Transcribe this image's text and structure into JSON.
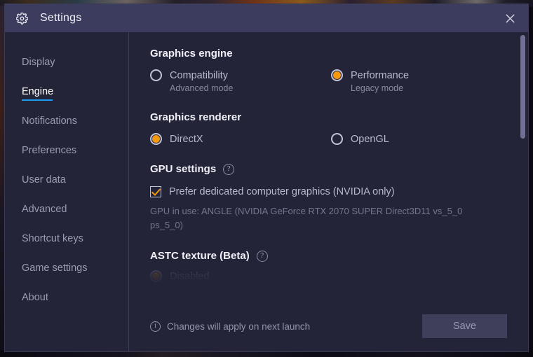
{
  "window": {
    "title": "Settings",
    "gear_icon": "gear-icon",
    "close_icon": "✕"
  },
  "sidebar": {
    "items": [
      {
        "label": "Display",
        "active": false
      },
      {
        "label": "Engine",
        "active": true
      },
      {
        "label": "Notifications",
        "active": false
      },
      {
        "label": "Preferences",
        "active": false
      },
      {
        "label": "User data",
        "active": false
      },
      {
        "label": "Advanced",
        "active": false
      },
      {
        "label": "Shortcut keys",
        "active": false
      },
      {
        "label": "Game settings",
        "active": false
      },
      {
        "label": "About",
        "active": false
      }
    ]
  },
  "content": {
    "graphics_engine": {
      "title": "Graphics engine",
      "options": [
        {
          "label": "Compatibility",
          "sub": "Advanced mode",
          "selected": false
        },
        {
          "label": "Performance",
          "sub": "Legacy mode",
          "selected": true
        }
      ]
    },
    "graphics_renderer": {
      "title": "Graphics renderer",
      "options": [
        {
          "label": "DirectX",
          "selected": true
        },
        {
          "label": "OpenGL",
          "selected": false
        }
      ]
    },
    "gpu_settings": {
      "title": "GPU settings",
      "help_icon": "?",
      "checkbox_label": "Prefer dedicated computer graphics (NVIDIA only)",
      "checkbox_checked": true,
      "gpu_in_use": "GPU in use: ANGLE (NVIDIA GeForce RTX 2070 SUPER Direct3D11 vs_5_0 ps_5_0)"
    },
    "astc_texture": {
      "title": "ASTC texture (Beta)",
      "help_icon": "?",
      "options": [
        {
          "label": "Disabled",
          "selected": true
        }
      ]
    }
  },
  "footer": {
    "info_icon": "i",
    "note": "Changes will apply on next launch",
    "save_label": "Save"
  },
  "colors": {
    "accent_orange": "#f5980b",
    "accent_blue": "#1e9bf0",
    "window_bg": "#242438",
    "titlebar_bg": "#3c3c5e"
  }
}
